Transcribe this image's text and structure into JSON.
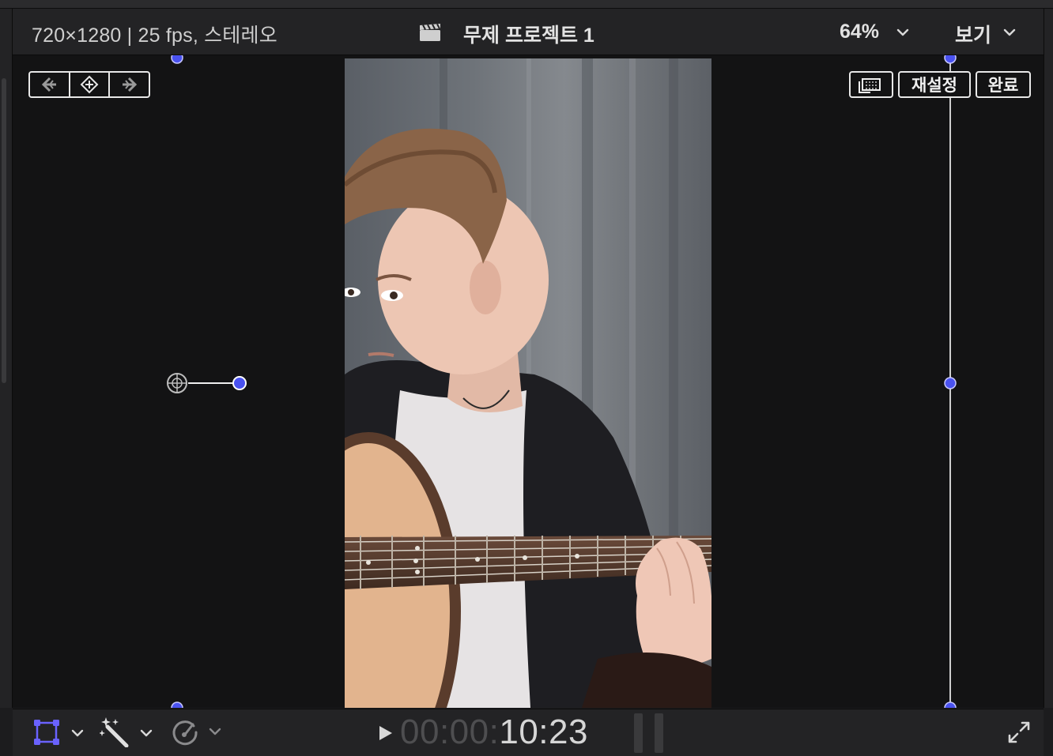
{
  "header": {
    "format": "720×1280 | 25 fps, 스테레오",
    "project_title": "무제 프로젝트 1",
    "zoom": "64%",
    "view_menu": "보기"
  },
  "transform_controls": {
    "reset_label": "재설정",
    "done_label": "완료"
  },
  "playback": {
    "timecode_dim": "00:00:",
    "timecode_bright": "10:23"
  },
  "colors": {
    "handle_blue": "#4a52f0",
    "transform_icon": "#6a62ff"
  },
  "icons": {
    "format_chevron": "chevron-down-icon",
    "clapper": "clapperboard-icon",
    "keyframe_prev": "arrow-left-icon",
    "keyframe_add": "diamond-plus-icon",
    "keyframe_next": "arrow-right-icon",
    "aspect": "aspect-frame-icon",
    "transform": "transform-icon",
    "enhance": "magic-wand-icon",
    "retime": "speedometer-icon",
    "play": "play-icon",
    "fullscreen": "expand-icon"
  }
}
